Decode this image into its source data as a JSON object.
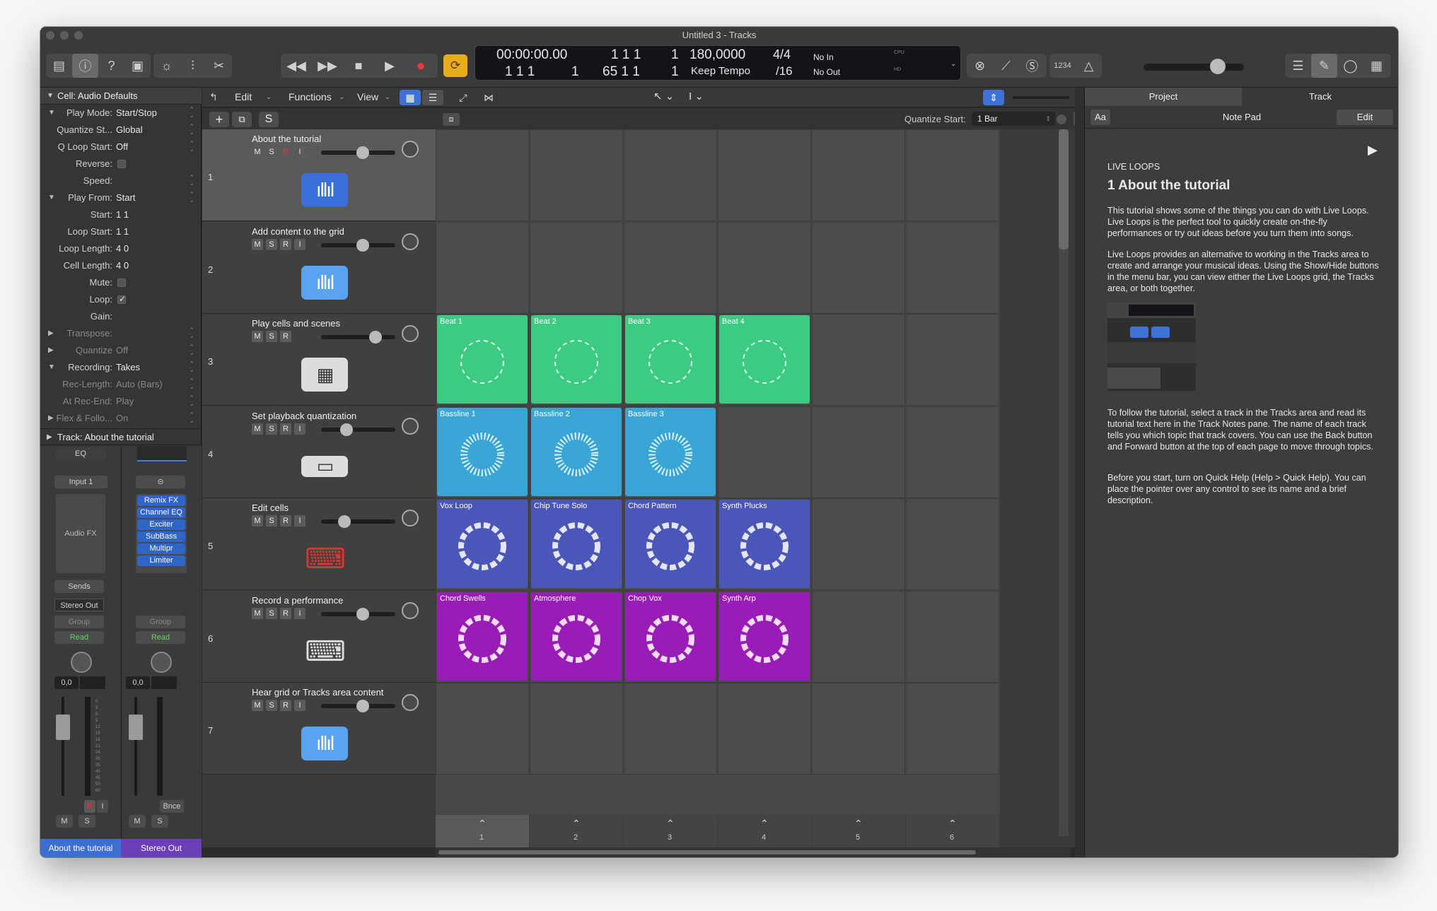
{
  "window": {
    "title": "Untitled 3 - Tracks"
  },
  "lcd": {
    "time": "00:00:00.00",
    "bars_top": "1  1  1",
    "bars_top_tail": "1",
    "tempo": "180,0000",
    "tempo_label": "Keep Tempo",
    "sig_top": "4/4",
    "sig_bottom": "/16",
    "pos_bottom": "1  1  1",
    "pos_bottom_tail": "1",
    "pos_bottom2": "65  1  1",
    "pos_bottom2_tail": "1",
    "in": "No In",
    "out": "No Out",
    "cpu": "CPU",
    "hd": "HD"
  },
  "transport_right": {
    "count_in": "1234"
  },
  "inspector": {
    "header": "Cell: Audio Defaults",
    "rows": [
      {
        "label": "Play Mode:",
        "value": "Start/Stop"
      },
      {
        "label": "Quantize St...",
        "value": "Global"
      },
      {
        "label": "Q Loop Start:",
        "value": "Off"
      },
      {
        "label": "Reverse:",
        "value": ""
      },
      {
        "label": "Speed:",
        "value": ""
      },
      {
        "label": "Play From:",
        "value": "Start"
      },
      {
        "label": "Start:",
        "value": "1  1"
      },
      {
        "label": "Loop Start:",
        "value": "1  1"
      },
      {
        "label": "Loop Length:",
        "value": "4  0"
      },
      {
        "label": "Cell Length:",
        "value": "4  0"
      },
      {
        "label": "Mute:",
        "value": ""
      },
      {
        "label": "Loop:",
        "value": "✓"
      },
      {
        "label": "Gain:",
        "value": ""
      },
      {
        "label": "Transpose:",
        "value": ""
      },
      {
        "label": "Quantize",
        "value": "Off"
      },
      {
        "label": "Recording:",
        "value": "Takes"
      },
      {
        "label": "Rec-Length:",
        "value": "Auto (Bars)"
      },
      {
        "label": "At Rec-End:",
        "value": "Play"
      },
      {
        "label": "Flex & Follo...",
        "value": "On"
      }
    ],
    "track_header": "Track:  About the tutorial"
  },
  "strip1": {
    "eq": "EQ",
    "input": "Input 1",
    "audio_fx": "Audio FX",
    "sends": "Sends",
    "output": "Stereo Out",
    "group": "Group",
    "auto": "Read",
    "pan_value": "0,0",
    "r": "R",
    "i": "I",
    "m": "M",
    "s": "S",
    "name": "About the tutorial"
  },
  "strip2": {
    "plugins": [
      "Remix FX",
      "Channel EQ",
      "Exciter",
      "SubBass",
      "Multipr",
      "Limiter"
    ],
    "group": "Group",
    "auto": "Read",
    "pan_value": "0,0",
    "bnce": "Bnce",
    "m": "M",
    "s": "S",
    "name": "Stereo Out"
  },
  "fader_scale": [
    "0",
    "3",
    "6",
    "9",
    "12",
    "15",
    "18",
    "21",
    "24",
    "30",
    "35",
    "40",
    "45",
    "50",
    "60"
  ],
  "menubar": {
    "edit": "Edit",
    "functions": "Functions",
    "view": "View"
  },
  "header_row": {
    "s": "S",
    "quantize_label": "Quantize Start:",
    "quantize_value": "1 Bar"
  },
  "tracks": [
    {
      "num": "1",
      "name": "About the tutorial",
      "buttons": [
        "M",
        "S",
        "R",
        "I"
      ]
    },
    {
      "num": "2",
      "name": "Add content to the grid",
      "buttons": [
        "M",
        "S",
        "R",
        "I"
      ]
    },
    {
      "num": "3",
      "name": "Play cells and scenes",
      "buttons": [
        "M",
        "S",
        "R"
      ]
    },
    {
      "num": "4",
      "name": "Set playback quantization",
      "buttons": [
        "M",
        "S",
        "R",
        "I"
      ]
    },
    {
      "num": "5",
      "name": "Edit cells",
      "buttons": [
        "M",
        "S",
        "R",
        "I"
      ]
    },
    {
      "num": "6",
      "name": "Record a performance",
      "buttons": [
        "M",
        "S",
        "R",
        "I"
      ]
    },
    {
      "num": "7",
      "name": "Hear grid or Tracks area content",
      "buttons": [
        "M",
        "S",
        "R",
        "I"
      ]
    }
  ],
  "cells": {
    "row3": [
      "Beat 1",
      "Beat 2",
      "Beat 3",
      "Beat 4"
    ],
    "row4": [
      "Bassline 1",
      "Bassline 2",
      "Bassline 3"
    ],
    "row5": [
      "Vox Loop",
      "Chip Tune Solo",
      "Chord Pattern",
      "Synth Plucks"
    ],
    "row6": [
      "Chord Swells",
      "Atmosphere",
      "Chop Vox",
      "Synth Arp"
    ]
  },
  "colors": {
    "beat": "#3bcb83",
    "bass": "#3aa6d6",
    "vox": "#4a56b8",
    "swell": "#9a1cb6"
  },
  "scenes": [
    "1",
    "2",
    "3",
    "4",
    "5",
    "6"
  ],
  "notepad": {
    "tab_project": "Project",
    "tab_track": "Track",
    "aa": "Aa",
    "title": "Note Pad",
    "edit": "Edit",
    "section": "LIVE LOOPS",
    "heading": "1 About the tutorial",
    "p1": "This tutorial shows some of the things you can do with Live Loops. Live Loops is the perfect tool to quickly create on-the-fly performances or try out ideas before you turn them into songs.",
    "p2": "Live Loops provides an alternative to working in the Tracks area to create and arrange your musical ideas. Using the Show/Hide buttons in the menu bar, you can view either the Live Loops grid, the Tracks area, or both together.",
    "p3": "To follow the tutorial, select a track in the Tracks area and read its tutorial text here in the Track Notes pane. The name of each track tells you which topic that track covers. You can use the Back button and Forward button at the top of each page to move through topics.",
    "p4": "Before you start, turn on Quick Help (Help > Quick Help). You can place the pointer over any control to see its name and a brief description."
  }
}
